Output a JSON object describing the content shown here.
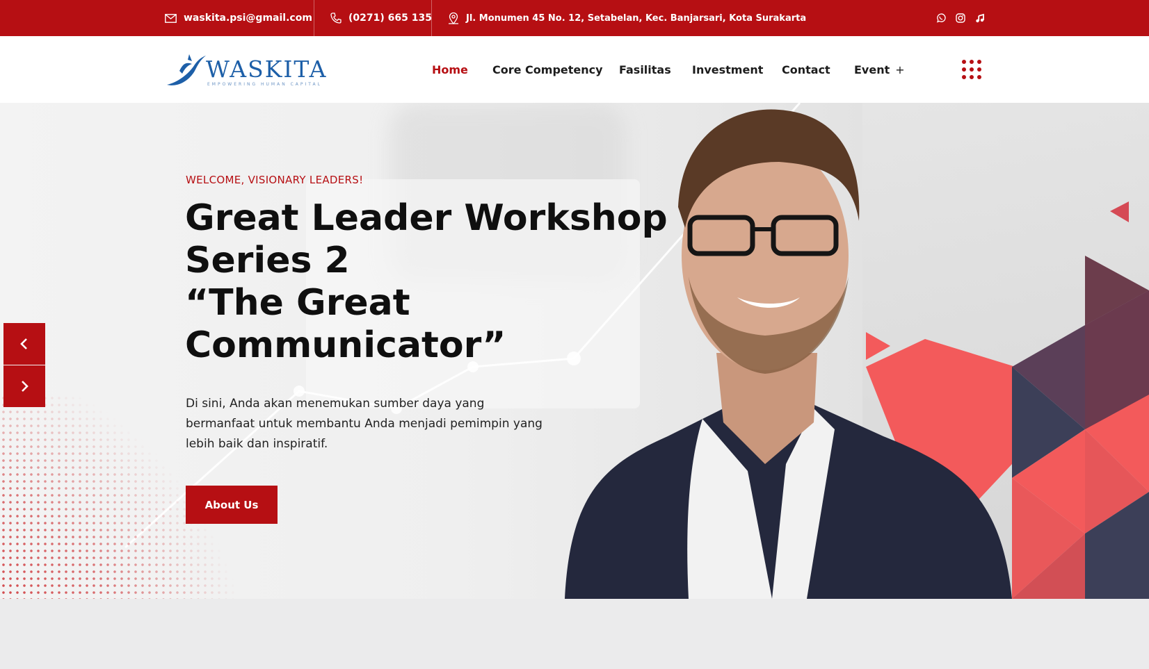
{
  "topbar": {
    "email": "waskita.psi@gmail.com",
    "phone": "(0271) 665 135",
    "address": "Jl. Monumen 45 No. 12, Setabelan, Kec. Banjarsari, Kota Surakarta",
    "socials": [
      "whatsapp-icon",
      "instagram-icon",
      "tiktok-icon"
    ]
  },
  "header": {
    "logo_text": "WASKITA",
    "logo_tagline": "EMPOWERING HUMAN CAPITAL",
    "nav": [
      "Home",
      "Core Competency",
      "Fasilitas",
      "Investment",
      "Contact",
      "Event"
    ],
    "event_plus": "+",
    "active": "Home"
  },
  "hero": {
    "eyebrow": "WELCOME, VISIONARY LEADERS!",
    "headline": [
      "Great Leader Workshop",
      "Series 2",
      "“The Great",
      "Communicator”"
    ],
    "description": "Di sini, Anda akan menemukan sumber daya yang bermanfaat untuk membantu Anda menjadi pemimpin yang lebih baik dan inspiratif.",
    "cta": "About Us"
  },
  "colors": {
    "brand_red": "#b60f13",
    "logo_blue": "#1d5fa8",
    "triangle_coral": "#f35a5b",
    "triangle_slate": "#3c3f58"
  }
}
